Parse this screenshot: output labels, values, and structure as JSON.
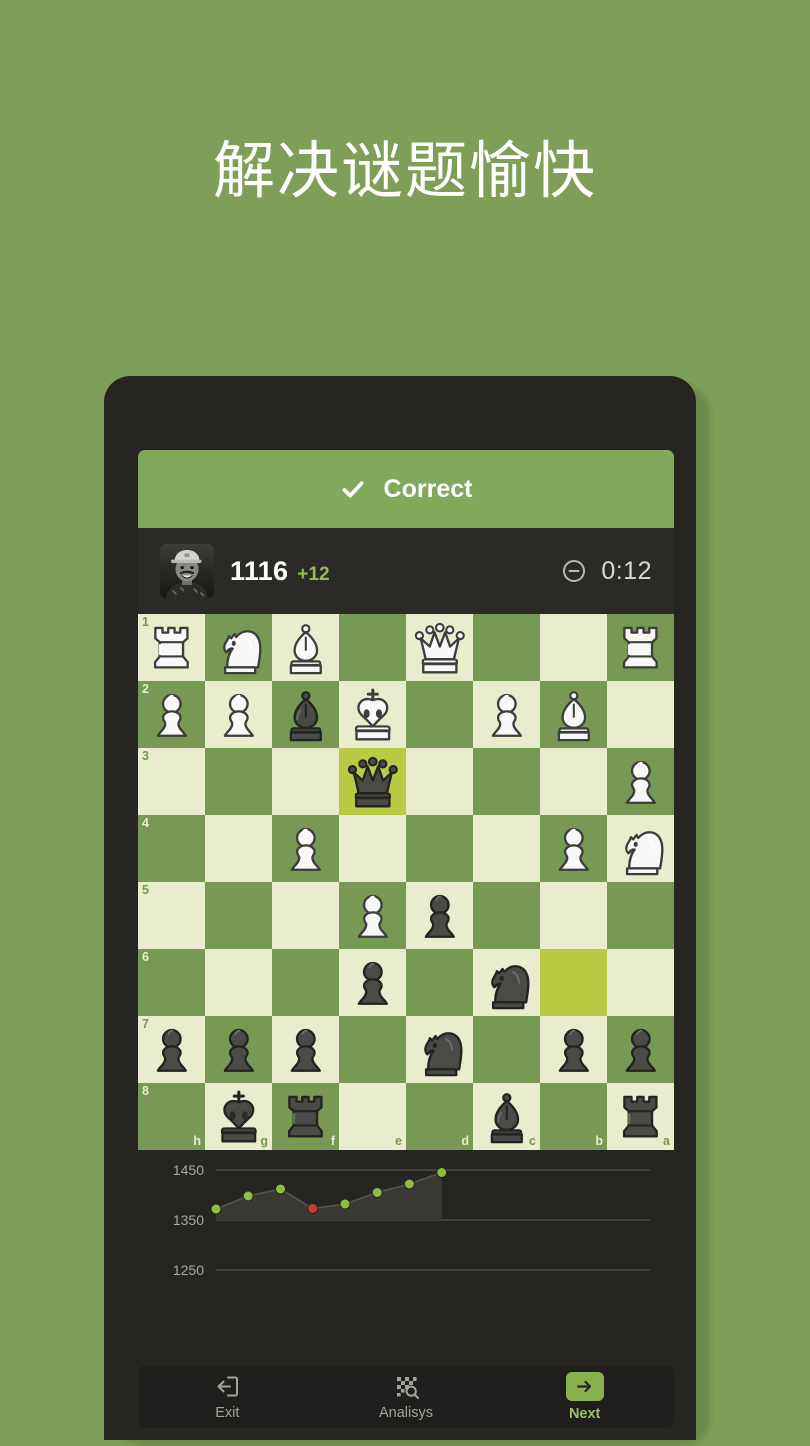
{
  "page": {
    "headline": "解决谜题愉快",
    "background_color": "#7e9f57"
  },
  "banner": {
    "label": "Correct",
    "icon": "check-icon",
    "color": "#81a95c"
  },
  "player": {
    "avatar_icon": "user-avatar",
    "rating": "1116",
    "rating_delta": "+12",
    "delta_color": "#95bb5e",
    "timer_icon": "timer-minus-icon",
    "timer": "0:12"
  },
  "board": {
    "orientation": "black",
    "light_color": "#e9edcd",
    "dark_color": "#779954",
    "highlight_color": "#b9cb45",
    "file_labels": [
      "h",
      "g",
      "f",
      "e",
      "d",
      "c",
      "b",
      "a"
    ],
    "rank_labels": [
      "1",
      "2",
      "3",
      "4",
      "5",
      "6",
      "7",
      "8"
    ],
    "highlighted_squares": [
      "e3",
      "b6"
    ],
    "rows": [
      [
        {
          "piece": "white-rook",
          "file": "h",
          "rank": "1"
        },
        {
          "piece": "white-knight",
          "file": "g",
          "rank": "1"
        },
        {
          "piece": "white-bishop",
          "file": "f",
          "rank": "1"
        },
        {
          "piece": "",
          "file": "e",
          "rank": "1"
        },
        {
          "piece": "white-queen",
          "file": "d",
          "rank": "1"
        },
        {
          "piece": "",
          "file": "c",
          "rank": "1"
        },
        {
          "piece": "",
          "file": "b",
          "rank": "1"
        },
        {
          "piece": "white-rook",
          "file": "a",
          "rank": "1"
        }
      ],
      [
        {
          "piece": "white-pawn",
          "file": "h",
          "rank": "2"
        },
        {
          "piece": "white-pawn",
          "file": "g",
          "rank": "2"
        },
        {
          "piece": "black-bishop",
          "file": "f",
          "rank": "2"
        },
        {
          "piece": "white-king",
          "file": "e",
          "rank": "2"
        },
        {
          "piece": "",
          "file": "d",
          "rank": "2"
        },
        {
          "piece": "white-pawn",
          "file": "c",
          "rank": "2"
        },
        {
          "piece": "white-bishop",
          "file": "b",
          "rank": "2"
        },
        {
          "piece": "",
          "file": "a",
          "rank": "2"
        }
      ],
      [
        {
          "piece": "",
          "file": "h",
          "rank": "3"
        },
        {
          "piece": "",
          "file": "g",
          "rank": "3"
        },
        {
          "piece": "",
          "file": "f",
          "rank": "3"
        },
        {
          "piece": "black-queen",
          "file": "e",
          "rank": "3"
        },
        {
          "piece": "",
          "file": "d",
          "rank": "3"
        },
        {
          "piece": "",
          "file": "c",
          "rank": "3"
        },
        {
          "piece": "",
          "file": "b",
          "rank": "3"
        },
        {
          "piece": "white-pawn",
          "file": "a",
          "rank": "3"
        }
      ],
      [
        {
          "piece": "",
          "file": "h",
          "rank": "4"
        },
        {
          "piece": "",
          "file": "g",
          "rank": "4"
        },
        {
          "piece": "white-pawn",
          "file": "f",
          "rank": "4"
        },
        {
          "piece": "",
          "file": "e",
          "rank": "4"
        },
        {
          "piece": "",
          "file": "d",
          "rank": "4"
        },
        {
          "piece": "",
          "file": "c",
          "rank": "4"
        },
        {
          "piece": "white-pawn",
          "file": "b",
          "rank": "4"
        },
        {
          "piece": "white-knight",
          "file": "a",
          "rank": "4"
        }
      ],
      [
        {
          "piece": "",
          "file": "h",
          "rank": "5"
        },
        {
          "piece": "",
          "file": "g",
          "rank": "5"
        },
        {
          "piece": "",
          "file": "f",
          "rank": "5"
        },
        {
          "piece": "white-pawn",
          "file": "e",
          "rank": "5"
        },
        {
          "piece": "black-pawn",
          "file": "d",
          "rank": "5"
        },
        {
          "piece": "",
          "file": "c",
          "rank": "5"
        },
        {
          "piece": "",
          "file": "b",
          "rank": "5"
        },
        {
          "piece": "",
          "file": "a",
          "rank": "5"
        }
      ],
      [
        {
          "piece": "",
          "file": "h",
          "rank": "6"
        },
        {
          "piece": "",
          "file": "g",
          "rank": "6"
        },
        {
          "piece": "",
          "file": "f",
          "rank": "6"
        },
        {
          "piece": "black-pawn",
          "file": "e",
          "rank": "6"
        },
        {
          "piece": "",
          "file": "d",
          "rank": "6"
        },
        {
          "piece": "black-knight",
          "file": "c",
          "rank": "6"
        },
        {
          "piece": "",
          "file": "b",
          "rank": "6"
        },
        {
          "piece": "",
          "file": "a",
          "rank": "6"
        }
      ],
      [
        {
          "piece": "black-pawn",
          "file": "h",
          "rank": "7"
        },
        {
          "piece": "black-pawn",
          "file": "g",
          "rank": "7"
        },
        {
          "piece": "black-pawn",
          "file": "f",
          "rank": "7"
        },
        {
          "piece": "",
          "file": "e",
          "rank": "7"
        },
        {
          "piece": "black-knight",
          "file": "d",
          "rank": "7"
        },
        {
          "piece": "",
          "file": "c",
          "rank": "7"
        },
        {
          "piece": "black-pawn",
          "file": "b",
          "rank": "7"
        },
        {
          "piece": "black-pawn",
          "file": "a",
          "rank": "7"
        }
      ],
      [
        {
          "piece": "",
          "file": "h",
          "rank": "8"
        },
        {
          "piece": "black-king",
          "file": "g",
          "rank": "8"
        },
        {
          "piece": "black-rook",
          "file": "f",
          "rank": "8"
        },
        {
          "piece": "",
          "file": "e",
          "rank": "8"
        },
        {
          "piece": "",
          "file": "d",
          "rank": "8"
        },
        {
          "piece": "black-bishop",
          "file": "c",
          "rank": "8"
        },
        {
          "piece": "",
          "file": "b",
          "rank": "8"
        },
        {
          "piece": "black-rook",
          "file": "a",
          "rank": "8"
        }
      ]
    ]
  },
  "chart_data": {
    "type": "line",
    "title": "",
    "xlabel": "",
    "ylabel": "",
    "ylim": [
      1250,
      1450
    ],
    "yticks": [
      1450,
      1350,
      1250
    ],
    "ytick_labels": [
      "1450",
      "1350",
      "1250"
    ],
    "grid": true,
    "legend": "none",
    "x": [
      1,
      2,
      3,
      4,
      5,
      6,
      7,
      8
    ],
    "values": [
      1372,
      1398,
      1412,
      1373,
      1382,
      1405,
      1422,
      1445
    ],
    "point_colors": [
      "#8ebe3f",
      "#8ebe3f",
      "#8ebe3f",
      "#cc3b34",
      "#8ebe3f",
      "#8ebe3f",
      "#8ebe3f",
      "#8ebe3f"
    ],
    "area_fill": "#3a3935",
    "line_color": "#56554f"
  },
  "bottom_nav": {
    "items": [
      {
        "label": "Exit",
        "icon": "exit-icon",
        "active": false
      },
      {
        "label": "Analisys",
        "icon": "analysis-icon",
        "active": false
      },
      {
        "label": "Next",
        "icon": "arrow-right-icon",
        "active": true
      }
    ],
    "accent_color": "#8ab04f"
  }
}
